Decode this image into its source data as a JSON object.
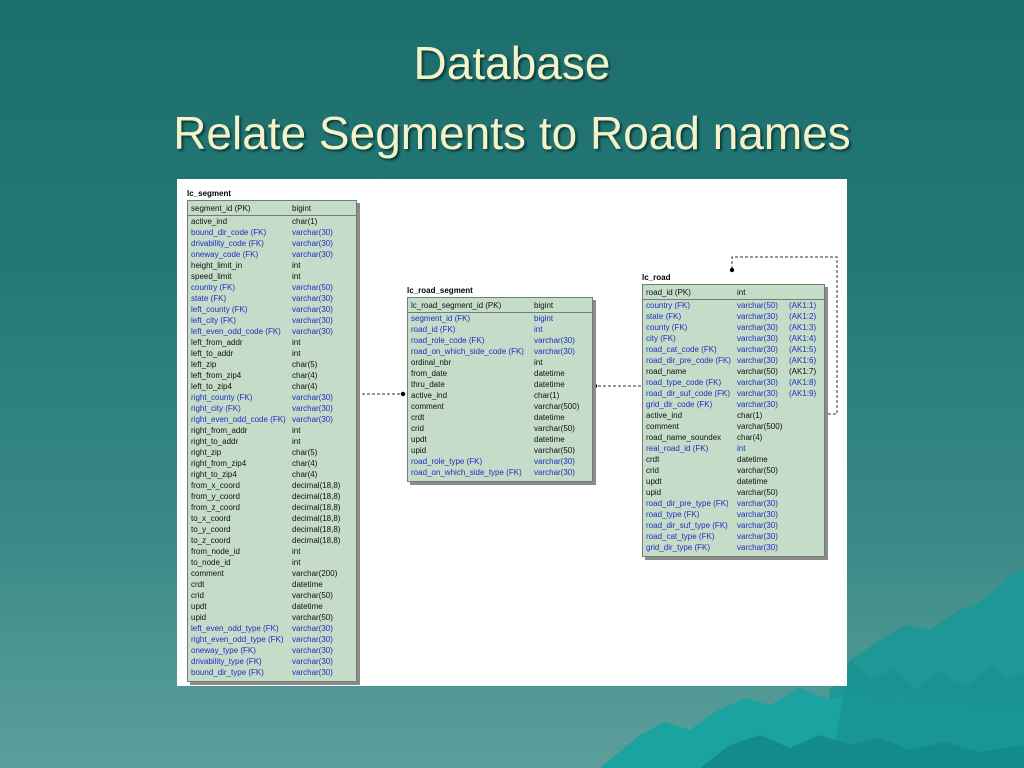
{
  "slide": {
    "title_line1": "Database",
    "title_line2": "Relate Segments to Road names"
  },
  "tables": [
    {
      "name": "lc_segment",
      "key": "lc-segment",
      "rows": [
        {
          "col": "segment_id (PK)",
          "type": "bigint",
          "ak": "",
          "fk": false
        },
        {
          "col": "active_ind",
          "type": "char(1)",
          "ak": "",
          "fk": false
        },
        {
          "col": "bound_dir_code (FK)",
          "type": "varchar(30)",
          "ak": "",
          "fk": true
        },
        {
          "col": "drivability_code (FK)",
          "type": "varchar(30)",
          "ak": "",
          "fk": true
        },
        {
          "col": "oneway_code (FK)",
          "type": "varchar(30)",
          "ak": "",
          "fk": true
        },
        {
          "col": "height_limit_in",
          "type": "int",
          "ak": "",
          "fk": false
        },
        {
          "col": "speed_limit",
          "type": "int",
          "ak": "",
          "fk": false
        },
        {
          "col": "country (FK)",
          "type": "varchar(50)",
          "ak": "",
          "fk": true
        },
        {
          "col": "state (FK)",
          "type": "varchar(30)",
          "ak": "",
          "fk": true
        },
        {
          "col": "left_county (FK)",
          "type": "varchar(30)",
          "ak": "",
          "fk": true
        },
        {
          "col": "left_city (FK)",
          "type": "varchar(30)",
          "ak": "",
          "fk": true
        },
        {
          "col": "left_even_odd_code (FK)",
          "type": "varchar(30)",
          "ak": "",
          "fk": true
        },
        {
          "col": "left_from_addr",
          "type": "int",
          "ak": "",
          "fk": false
        },
        {
          "col": "left_to_addr",
          "type": "int",
          "ak": "",
          "fk": false
        },
        {
          "col": "left_zip",
          "type": "char(5)",
          "ak": "",
          "fk": false
        },
        {
          "col": "left_from_zip4",
          "type": "char(4)",
          "ak": "",
          "fk": false
        },
        {
          "col": "left_to_zip4",
          "type": "char(4)",
          "ak": "",
          "fk": false
        },
        {
          "col": "right_county (FK)",
          "type": "varchar(30)",
          "ak": "",
          "fk": true
        },
        {
          "col": "right_city (FK)",
          "type": "varchar(30)",
          "ak": "",
          "fk": true
        },
        {
          "col": "right_even_odd_code (FK)",
          "type": "varchar(30)",
          "ak": "",
          "fk": true
        },
        {
          "col": "right_from_addr",
          "type": "int",
          "ak": "",
          "fk": false
        },
        {
          "col": "right_to_addr",
          "type": "int",
          "ak": "",
          "fk": false
        },
        {
          "col": "right_zip",
          "type": "char(5)",
          "ak": "",
          "fk": false
        },
        {
          "col": "right_from_zip4",
          "type": "char(4)",
          "ak": "",
          "fk": false
        },
        {
          "col": "right_to_zip4",
          "type": "char(4)",
          "ak": "",
          "fk": false
        },
        {
          "col": "from_x_coord",
          "type": "decimal(18,8)",
          "ak": "",
          "fk": false
        },
        {
          "col": "from_y_coord",
          "type": "decimal(18,8)",
          "ak": "",
          "fk": false
        },
        {
          "col": "from_z_coord",
          "type": "decimal(18,8)",
          "ak": "",
          "fk": false
        },
        {
          "col": "to_x_coord",
          "type": "decimal(18,8)",
          "ak": "",
          "fk": false
        },
        {
          "col": "to_y_coord",
          "type": "decimal(18,8)",
          "ak": "",
          "fk": false
        },
        {
          "col": "to_z_coord",
          "type": "decimal(18,8)",
          "ak": "",
          "fk": false
        },
        {
          "col": "from_node_id",
          "type": "int",
          "ak": "",
          "fk": false
        },
        {
          "col": "to_node_id",
          "type": "int",
          "ak": "",
          "fk": false
        },
        {
          "col": "comment",
          "type": "varchar(200)",
          "ak": "",
          "fk": false
        },
        {
          "col": "crdt",
          "type": "datetime",
          "ak": "",
          "fk": false
        },
        {
          "col": "crid",
          "type": "varchar(50)",
          "ak": "",
          "fk": false
        },
        {
          "col": "updt",
          "type": "datetime",
          "ak": "",
          "fk": false
        },
        {
          "col": "upid",
          "type": "varchar(50)",
          "ak": "",
          "fk": false
        },
        {
          "col": "left_even_odd_type (FK)",
          "type": "varchar(30)",
          "ak": "",
          "fk": true
        },
        {
          "col": "right_even_odd_type (FK)",
          "type": "varchar(30)",
          "ak": "",
          "fk": true
        },
        {
          "col": "oneway_type (FK)",
          "type": "varchar(30)",
          "ak": "",
          "fk": true
        },
        {
          "col": "drivability_type (FK)",
          "type": "varchar(30)",
          "ak": "",
          "fk": true
        },
        {
          "col": "bound_dir_type (FK)",
          "type": "varchar(30)",
          "ak": "",
          "fk": true
        }
      ]
    },
    {
      "name": "lc_road_segment",
      "key": "lc-road-segment",
      "rows": [
        {
          "col": "lc_road_segment_id (PK)",
          "type": "bigint",
          "ak": "",
          "fk": false
        },
        {
          "col": "segment_id (FK)",
          "type": "bigint",
          "ak": "",
          "fk": true
        },
        {
          "col": "road_id (FK)",
          "type": "int",
          "ak": "",
          "fk": true
        },
        {
          "col": "road_role_code (FK)",
          "type": "varchar(30)",
          "ak": "",
          "fk": true
        },
        {
          "col": "road_on_which_side_code (FK)",
          "type": "varchar(30)",
          "ak": "",
          "fk": true
        },
        {
          "col": "ordinal_nbr",
          "type": "int",
          "ak": "",
          "fk": false
        },
        {
          "col": "from_date",
          "type": "datetime",
          "ak": "",
          "fk": false
        },
        {
          "col": "thru_date",
          "type": "datetime",
          "ak": "",
          "fk": false
        },
        {
          "col": "active_ind",
          "type": "char(1)",
          "ak": "",
          "fk": false
        },
        {
          "col": "comment",
          "type": "varchar(500)",
          "ak": "",
          "fk": false
        },
        {
          "col": "crdt",
          "type": "datetime",
          "ak": "",
          "fk": false
        },
        {
          "col": "crid",
          "type": "varchar(50)",
          "ak": "",
          "fk": false
        },
        {
          "col": "updt",
          "type": "datetime",
          "ak": "",
          "fk": false
        },
        {
          "col": "upid",
          "type": "varchar(50)",
          "ak": "",
          "fk": false
        },
        {
          "col": "road_role_type (FK)",
          "type": "varchar(30)",
          "ak": "",
          "fk": true
        },
        {
          "col": "road_on_which_side_type (FK)",
          "type": "varchar(30)",
          "ak": "",
          "fk": true
        }
      ]
    },
    {
      "name": "lc_road",
      "key": "lc-road",
      "rows": [
        {
          "col": "road_id (PK)",
          "type": "int",
          "ak": "",
          "fk": false
        },
        {
          "col": "country (FK)",
          "type": "varchar(50)",
          "ak": "(AK1:1)",
          "fk": true
        },
        {
          "col": "state (FK)",
          "type": "varchar(30)",
          "ak": "(AK1:2)",
          "fk": true
        },
        {
          "col": "county (FK)",
          "type": "varchar(30)",
          "ak": "(AK1:3)",
          "fk": true
        },
        {
          "col": "city (FK)",
          "type": "varchar(30)",
          "ak": "(AK1:4)",
          "fk": true
        },
        {
          "col": "road_cat_code (FK)",
          "type": "varchar(30)",
          "ak": "(AK1:5)",
          "fk": true
        },
        {
          "col": "road_dir_pre_code (FK)",
          "type": "varchar(30)",
          "ak": "(AK1:6)",
          "fk": true
        },
        {
          "col": "road_name",
          "type": "varchar(50)",
          "ak": "(AK1:7)",
          "fk": false
        },
        {
          "col": "road_type_code (FK)",
          "type": "varchar(30)",
          "ak": "(AK1:8)",
          "fk": true
        },
        {
          "col": "road_dir_suf_code (FK)",
          "type": "varchar(30)",
          "ak": "(AK1:9)",
          "fk": true
        },
        {
          "col": "grid_dir_code (FK)",
          "type": "varchar(30)",
          "ak": "",
          "fk": true
        },
        {
          "col": "active_ind",
          "type": "char(1)",
          "ak": "",
          "fk": false
        },
        {
          "col": "comment",
          "type": "varchar(500)",
          "ak": "",
          "fk": false
        },
        {
          "col": "road_name_soundex",
          "type": "char(4)",
          "ak": "",
          "fk": false
        },
        {
          "col": "real_road_id (FK)",
          "type": "int",
          "ak": "",
          "fk": true
        },
        {
          "col": "crdt",
          "type": "datetime",
          "ak": "",
          "fk": false
        },
        {
          "col": "crid",
          "type": "varchar(50)",
          "ak": "",
          "fk": false
        },
        {
          "col": "updt",
          "type": "datetime",
          "ak": "",
          "fk": false
        },
        {
          "col": "upid",
          "type": "varchar(50)",
          "ak": "",
          "fk": false
        },
        {
          "col": "road_dir_pre_type (FK)",
          "type": "varchar(30)",
          "ak": "",
          "fk": true
        },
        {
          "col": "road_type (FK)",
          "type": "varchar(30)",
          "ak": "",
          "fk": true
        },
        {
          "col": "road_dir_suf_type (FK)",
          "type": "varchar(30)",
          "ak": "",
          "fk": true
        },
        {
          "col": "road_cat_type (FK)",
          "type": "varchar(30)",
          "ak": "",
          "fk": true
        },
        {
          "col": "grid_dir_type (FK)",
          "type": "varchar(30)",
          "ak": "",
          "fk": true
        }
      ]
    }
  ],
  "colors": {
    "fk_text": "#1f2fbf",
    "table_fill": "#c5dcc9",
    "title_text": "#f4f2c8"
  }
}
